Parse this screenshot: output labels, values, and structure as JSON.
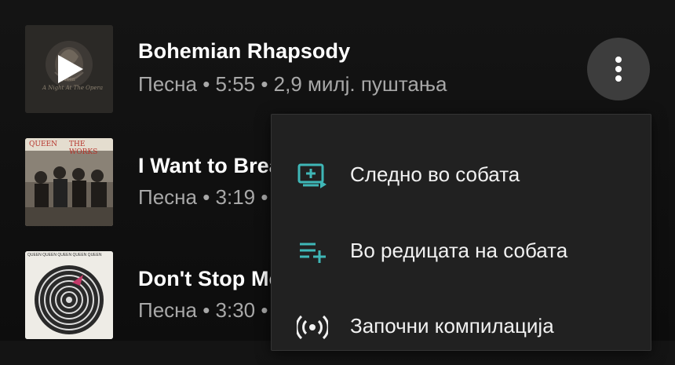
{
  "songs": [
    {
      "title": "Bohemian Rhapsody",
      "meta": "Песна • 5:55 • 2,9 милј. пуштања",
      "art_text": "A Night At The Opera",
      "art_brand": "Queen"
    },
    {
      "title": "I Want to Break Free",
      "meta": "Песна • 3:19 •",
      "art_band": "QUEEN",
      "art_album": "THE WORKS"
    },
    {
      "title": "Don't Stop Me Now",
      "meta": "Песна • 3:30 •",
      "art_strip": "QUEEN QUEEN QUEEN QUEEN QUEEN"
    }
  ],
  "more_button": {
    "icon": "more-vert-icon"
  },
  "menu": {
    "items": [
      {
        "label": "Следно во собата",
        "icon": "play-next-icon"
      },
      {
        "label": "Во редицата на собата",
        "icon": "add-to-queue-icon"
      },
      {
        "label": "Започни компилација",
        "icon": "radio-icon"
      }
    ]
  },
  "colors": {
    "accent": "#3fb7b7",
    "background": "#111111",
    "menu_bg": "#212121",
    "secondary_text": "#a8a8a8"
  }
}
